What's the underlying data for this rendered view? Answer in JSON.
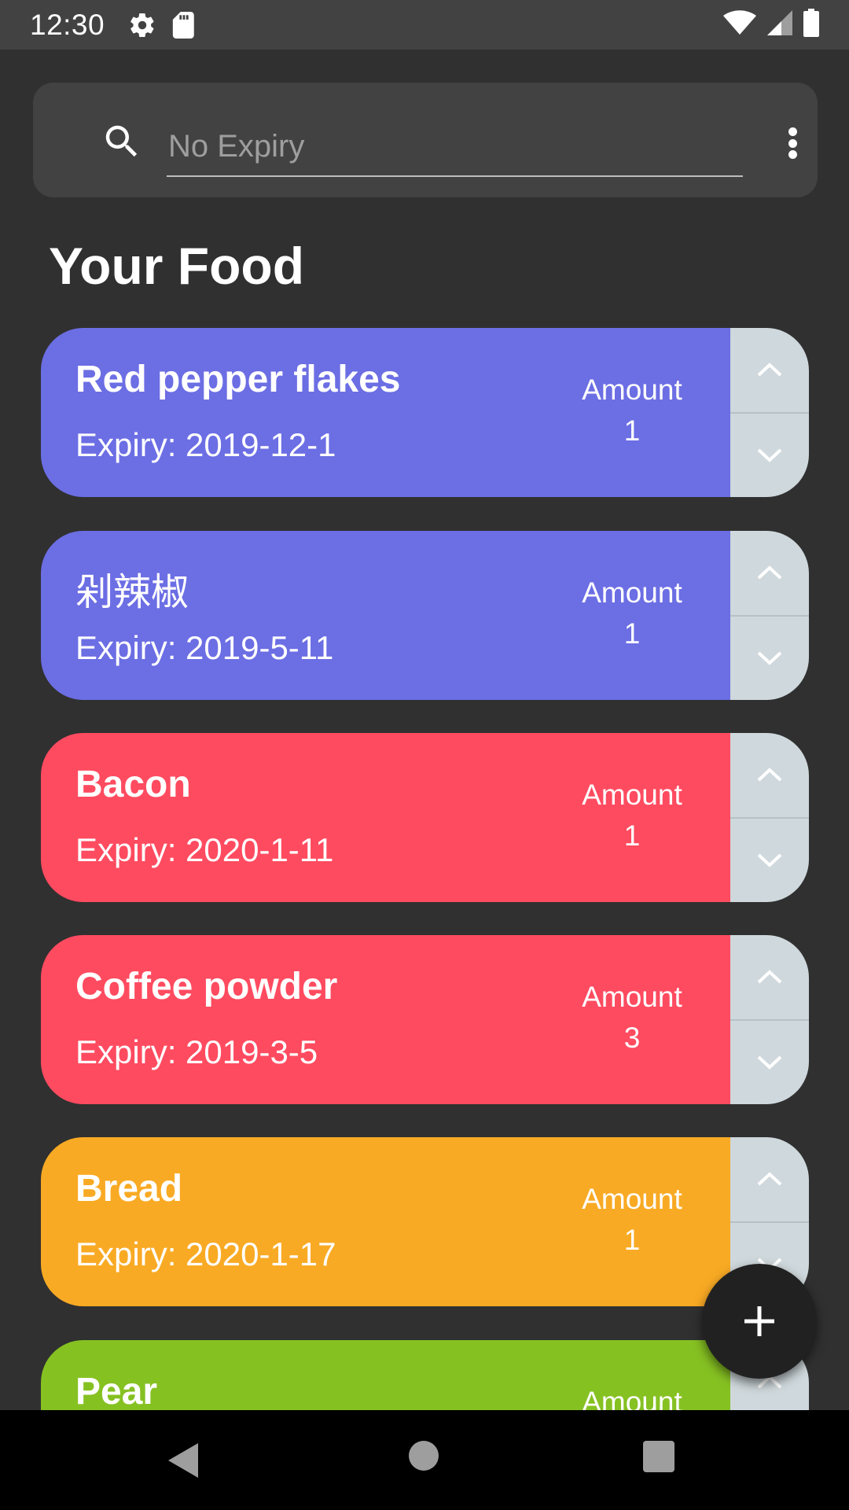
{
  "status_bar": {
    "time": "12:30",
    "left_icons": [
      "settings-icon",
      "sd-card-icon"
    ],
    "right_icons": [
      "wifi-icon",
      "signal-icon",
      "battery-icon"
    ]
  },
  "search": {
    "placeholder": "No Expiry",
    "value": "",
    "icons": [
      "search-icon",
      "more-vertical-icon"
    ]
  },
  "heading": "Your Food",
  "foods": [
    {
      "name": "Red pepper flakes",
      "expiry": "Expiry: 2019-12-1",
      "amount_label": "Amount",
      "amount": "1",
      "color": "#6c6ee4"
    },
    {
      "name": "剁辣椒",
      "expiry": "Expiry: 2019-5-11",
      "amount_label": "Amount",
      "amount": "1",
      "color": "#6c6ee4"
    },
    {
      "name": "Bacon",
      "expiry": "Expiry: 2020-1-11",
      "amount_label": "Amount",
      "amount": "1",
      "color": "#ff4b60"
    },
    {
      "name": "Coffee powder",
      "expiry": "Expiry: 2019-3-5",
      "amount_label": "Amount",
      "amount": "3",
      "color": "#ff4b60"
    },
    {
      "name": "Bread",
      "expiry": "Expiry: 2020-1-17",
      "amount_label": "Amount",
      "amount": "1",
      "color": "#f9aa24"
    },
    {
      "name": "Pear",
      "expiry": "",
      "amount_label": "Amount",
      "amount": "",
      "color": "#86c122"
    }
  ],
  "fab": {
    "icon": "plus-icon"
  },
  "nav": {
    "icons": [
      "back-icon",
      "home-icon",
      "recents-icon"
    ]
  },
  "colors": {
    "background": "#303030",
    "surface": "#424242",
    "stepper": "#cfd8dc",
    "fab": "#212121"
  }
}
